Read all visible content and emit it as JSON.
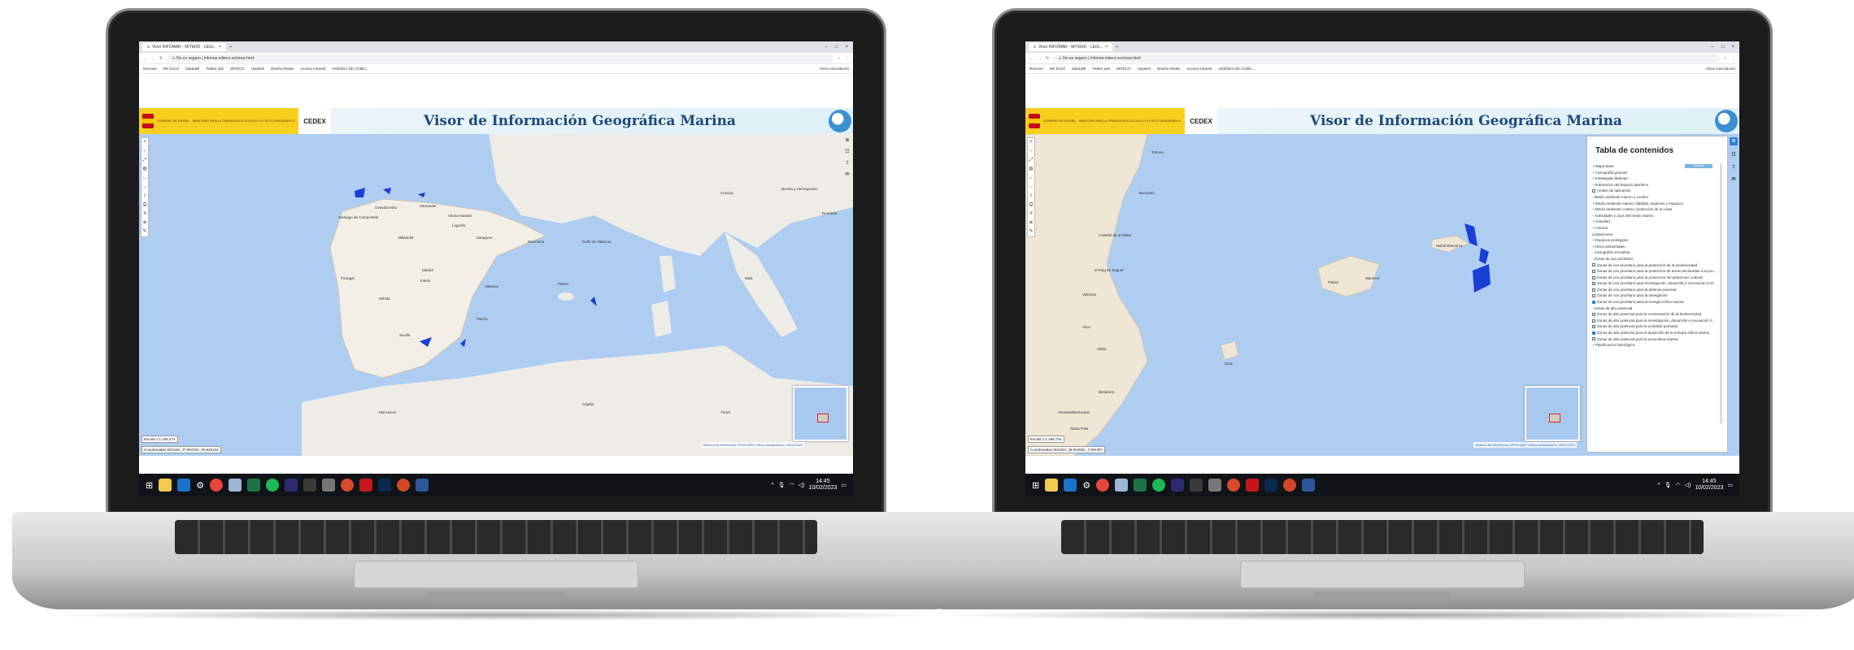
{
  "browser": {
    "tab_title": "Visor INFOMAR - MITERD - LEG/...",
    "window_controls": [
      "–",
      "□",
      "×"
    ],
    "address_warning": "No es seguro",
    "url": "infomar.miteco.es/visor.html",
    "bookmarks": [
      "Remove",
      "NG Excel",
      "Sabadell",
      "Twitter ads",
      "MITECO",
      "Unplash",
      "Diseño Redes",
      "Acceso intranet",
      "AGENDA DE COMU..."
    ],
    "other_bookmarks": "Otros marcadores"
  },
  "app": {
    "title": "Visor de Información Geográfica Marina",
    "gov_text": "GOBIERNO DE ESPAÑA",
    "ministry_text": "MINISTERIO PARA LA TRANSICIÓN ECOLÓGICA Y EL RETO DEMOGRÁFICO",
    "cedex": "CEDEX"
  },
  "left_screen": {
    "map_labels": [
      {
        "text": "Santiago de Compostela"
      },
      {
        "text": "Oviedo/Uviéu"
      },
      {
        "text": "Santander"
      },
      {
        "text": "Vitoria-Gasteiz"
      },
      {
        "text": "Logroño"
      },
      {
        "text": "Zaragoza"
      },
      {
        "text": "Valladolid"
      },
      {
        "text": "Barcelona"
      },
      {
        "text": "Portugal"
      },
      {
        "text": "Madrid"
      },
      {
        "text": "Toledo"
      },
      {
        "text": "Valencia"
      },
      {
        "text": "Palma"
      },
      {
        "text": "Mérida"
      },
      {
        "text": "Murcia"
      },
      {
        "text": "Sevilla"
      },
      {
        "text": "Golfo de Valencia"
      },
      {
        "text": "Túnez"
      },
      {
        "text": "Marruecos"
      },
      {
        "text": "Argelia"
      },
      {
        "text": "Bosnia y Herzegovina"
      },
      {
        "text": "Rumanía"
      },
      {
        "text": "Croacia"
      },
      {
        "text": "Italia"
      }
    ],
    "scale": "Escala 1:1.156.274",
    "coordinates": "Coordenadas WGS84: 37.997222, 20.915132",
    "credits": "Sistema de Referencia: EPSG:3857 Última actualización: 06/02/2023"
  },
  "right_screen": {
    "map_labels": [
      {
        "text": "Tortosa"
      },
      {
        "text": "Benicarló"
      },
      {
        "text": "Castelló de la Plana"
      },
      {
        "text": "el Puig de Sagunt"
      },
      {
        "text": "València"
      },
      {
        "text": "Palma"
      },
      {
        "text": "Manacor"
      },
      {
        "text": "Mahón/Menorca"
      },
      {
        "text": "Ibiza"
      },
      {
        "text": "Alcoi"
      },
      {
        "text": "Xàbia"
      },
      {
        "text": "Benidorm"
      },
      {
        "text": "Alcantarilla/Alacant"
      },
      {
        "text": "Santa Pola"
      }
    ],
    "scale": "Escala 1:1.456.734",
    "coordinates": "Coordenadas WGS84: 38.944581, 1.094397",
    "credits": "Sistema de Referencia: EPSG:3857 Última actualización: 06/02/2023",
    "toc": {
      "title": "Tabla de contenidos",
      "ok_label": "Aceptar",
      "items": [
        {
          "label": "+ Mapa Base",
          "checkbox": false
        },
        {
          "label": "+ Cartografía general",
          "checkbox": false
        },
        {
          "label": "+ Estrategias Marinas",
          "checkbox": false
        },
        {
          "label": "- Ordenación del Espacio Marítimo",
          "checkbox": false
        },
        {
          "label": "Ámbito de aplicación",
          "checkbox": true,
          "checked": false
        },
        {
          "label": "- Medio ambiente marino y costero",
          "checkbox": false
        },
        {
          "label": "+ Medio ambiente marino: hábitats, especies y espacios",
          "checkbox": false
        },
        {
          "label": "+ Medio ambiente costero: protección de la costa",
          "checkbox": false
        },
        {
          "label": "- Actividades y usos del medio marino",
          "checkbox": false
        },
        {
          "label": "+ Actividad",
          "checkbox": false
        },
        {
          "label": "+ Futuros",
          "checkbox": false
        },
        {
          "label": "Limitaciones",
          "checkbox": false
        },
        {
          "label": "+ Espacios protegidos",
          "checkbox": false
        },
        {
          "label": "+ Otros ambientales",
          "checkbox": false
        },
        {
          "label": "- Cartografía normativa",
          "checkbox": false
        },
        {
          "label": "- Zonas de uso prioritario",
          "checkbox": false
        },
        {
          "label": "Zonas de uso prioritario para la protección de la biodiversidad",
          "checkbox": true,
          "checked": false
        },
        {
          "label": "Zonas de uso prioritario para la protección de áreas declaradas a la protección costera",
          "checkbox": true,
          "checked": false
        },
        {
          "label": "Zonas de uso prioritario para la protección del patrimonio cultural",
          "checkbox": true,
          "checked": false
        },
        {
          "label": "Zonas de uso prioritario para investigación, desarrollo e innovación (I+D+i)",
          "checkbox": true,
          "checked": false
        },
        {
          "label": "Zonas de uso prioritario para la defensa nacional",
          "checkbox": true,
          "checked": false
        },
        {
          "label": "Zonas de uso prioritario para la navegación",
          "checkbox": true,
          "checked": false
        },
        {
          "label": "Zonas de uso prioritario para la energía eólica marina",
          "checkbox": true,
          "checked": true
        },
        {
          "label": "- Zonas de alto potencial",
          "checkbox": false
        },
        {
          "label": "Zonas de alto potencial para la conservación de la biodiversidad",
          "checkbox": true,
          "checked": false
        },
        {
          "label": "Zonas de alto potencial para la investigación, desarrollo e innovación (I+D+i)",
          "checkbox": true,
          "checked": false
        },
        {
          "label": "Zonas de alto potencial para la actividad portuaria",
          "checkbox": true,
          "checked": false
        },
        {
          "label": "Zonas de alto potencial para el desarrollo de la energía eólica marina",
          "checkbox": true,
          "checked": true
        },
        {
          "label": "Zonas de alto potencial para la acuicultura marina",
          "checkbox": true,
          "checked": false
        },
        {
          "label": "+ Planificación hidrológica",
          "checkbox": false
        }
      ]
    }
  },
  "taskbar": {
    "time": "14:45",
    "date": "10/02/2023",
    "apps": [
      {
        "name": "file-explorer",
        "color": "#f2c94c"
      },
      {
        "name": "outlook",
        "color": "#1a73c9"
      },
      {
        "name": "settings",
        "color": "#101418"
      },
      {
        "name": "chrome",
        "color": "#e8453c"
      },
      {
        "name": "notes",
        "color": "#9bb7d4"
      },
      {
        "name": "excel",
        "color": "#1f7244"
      },
      {
        "name": "spotify",
        "color": "#1db954"
      },
      {
        "name": "premiere",
        "color": "#2a2a6e"
      },
      {
        "name": "calculator",
        "color": "#3a3a3a"
      },
      {
        "name": "inkscape",
        "color": "#777777"
      },
      {
        "name": "app-red",
        "color": "#d84a2b"
      },
      {
        "name": "acrobat",
        "color": "#c4161c"
      },
      {
        "name": "photoshop",
        "color": "#0c2a4d"
      },
      {
        "name": "powerpoint",
        "color": "#d24726"
      },
      {
        "name": "word",
        "color": "#2b579a"
      }
    ]
  }
}
